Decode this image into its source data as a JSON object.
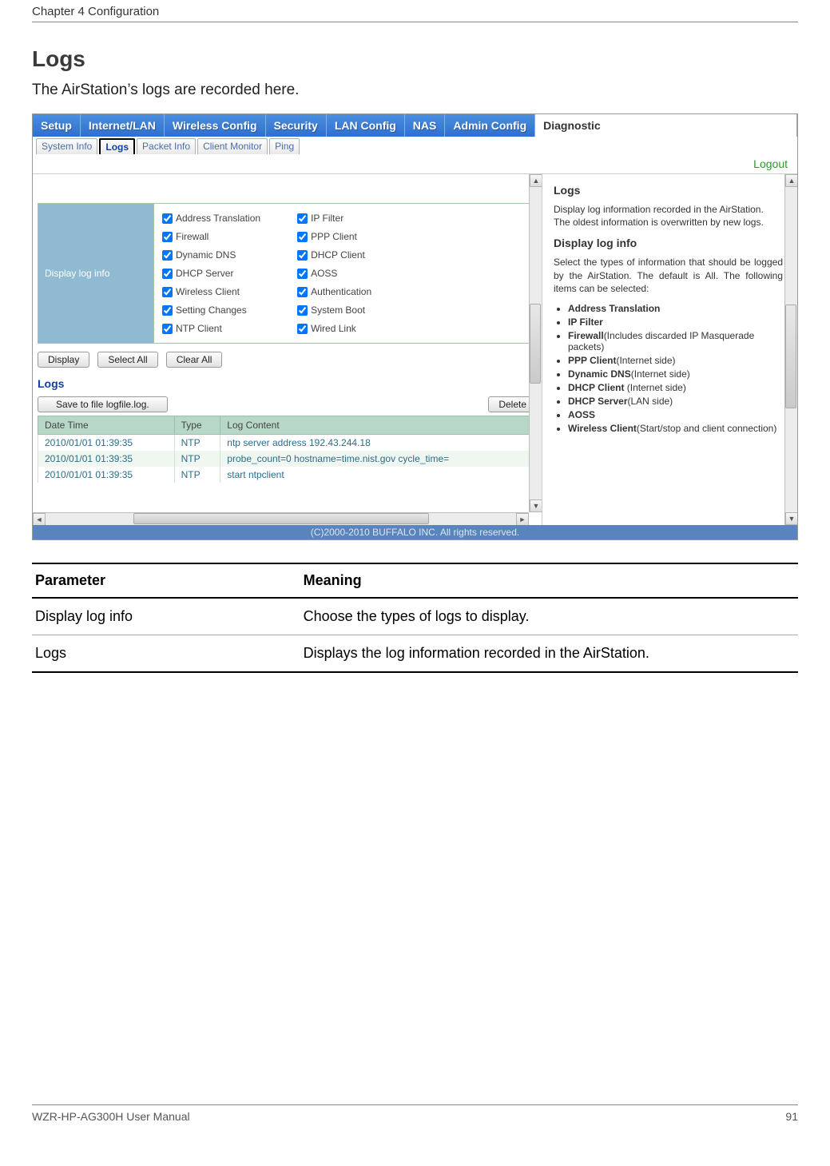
{
  "page": {
    "chapter": "Chapter 4  Configuration",
    "footer_left": "WZR-HP-AG300H User Manual",
    "footer_page": "91"
  },
  "section": {
    "title": "Logs",
    "description": "The AirStation’s logs are recorded here."
  },
  "screenshot": {
    "main_tabs": [
      "Setup",
      "Internet/LAN",
      "Wireless Config",
      "Security",
      "LAN Config",
      "NAS",
      "Admin Config",
      "Diagnostic"
    ],
    "sub_tabs": [
      "System Info",
      "Logs",
      "Packet Info",
      "Client Monitor",
      "Ping"
    ],
    "active_sub_tab": "Logs",
    "logout": "Logout",
    "display_label": "Display log info",
    "checkboxes_col1": [
      "Address Translation",
      "Firewall",
      "Dynamic DNS",
      "DHCP Server",
      "Wireless Client",
      "Setting Changes",
      "NTP Client"
    ],
    "checkboxes_col2": [
      "IP Filter",
      "PPP Client",
      "DHCP Client",
      "AOSS",
      "Authentication",
      "System Boot",
      "Wired Link"
    ],
    "buttons": {
      "display": "Display",
      "select_all": "Select All",
      "clear_all": "Clear All"
    },
    "logs_section_label": "Logs",
    "save_button": "Save to file logfile.log.",
    "delete_button": "Delete",
    "table_headers": {
      "datetime": "Date Time",
      "type": "Type",
      "content": "Log Content"
    },
    "table_rows": [
      {
        "dt": "2010/01/01 01:39:35",
        "type": "NTP",
        "content": "ntp server address 192.43.244.18"
      },
      {
        "dt": "2010/01/01 01:39:35",
        "type": "NTP",
        "content": "probe_count=0 hostname=time.nist.gov cycle_time="
      },
      {
        "dt": "2010/01/01 01:39:35",
        "type": "NTP",
        "content": "start ntpclient"
      }
    ],
    "help": {
      "title": "Logs",
      "p1": "Display log information recorded in the AirStation.",
      "p2": "The oldest information is overwritten by new logs.",
      "subtitle": "Display log info",
      "p3": "Select the types of information that should be logged by the AirStation. The default is All. The following items can be selected:",
      "items": [
        {
          "b": "Address Translation",
          "extra": ""
        },
        {
          "b": "IP Filter",
          "extra": ""
        },
        {
          "b": "Firewall",
          "extra": "(Includes discarded IP Masquerade packets)"
        },
        {
          "b": "PPP Client",
          "extra": "(Internet side)"
        },
        {
          "b": "Dynamic DNS",
          "extra": "(Internet side)"
        },
        {
          "b": "DHCP Client",
          "extra": " (Internet side)"
        },
        {
          "b": "DHCP Server",
          "extra": "(LAN side)"
        },
        {
          "b": "AOSS",
          "extra": ""
        },
        {
          "b": "Wireless Client",
          "extra": "(Start/stop and client connection)"
        }
      ]
    },
    "copyright": "(C)2000-2010 BUFFALO INC. All rights reserved."
  },
  "param_table": {
    "h1": "Parameter",
    "h2": "Meaning",
    "rows": [
      {
        "p": "Display log info",
        "m": "Choose the types of logs to display."
      },
      {
        "p": "Logs",
        "m": "Displays the log information recorded in the AirStation."
      }
    ]
  }
}
